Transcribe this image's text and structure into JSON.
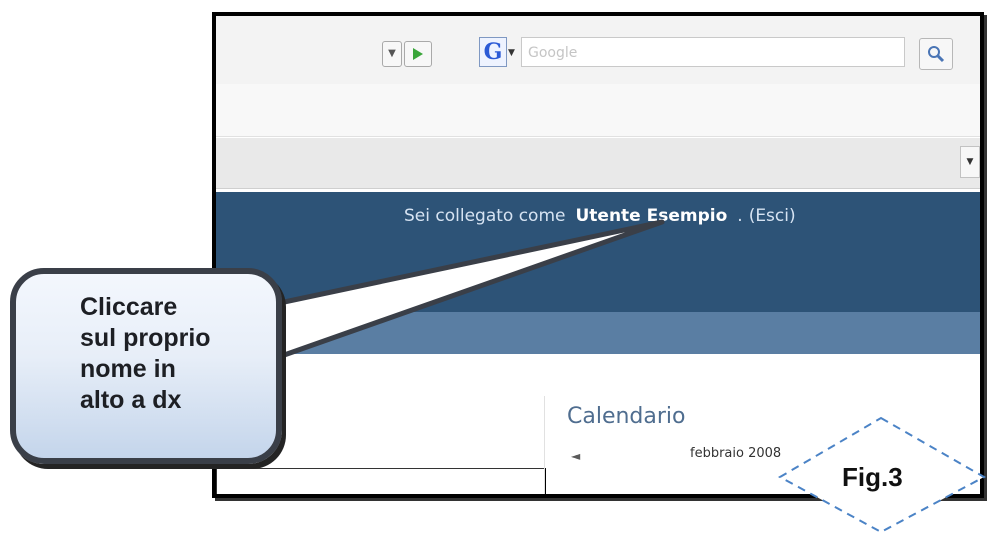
{
  "toolbar": {
    "search_placeholder": "Google",
    "google_badge": "G"
  },
  "header": {
    "login_prefix": "Sei collegato come",
    "user_name": "Utente Esempio",
    "separator": ".",
    "logout_link": "(Esci)"
  },
  "calendar": {
    "title": "Calendario",
    "prev_arrow": "◄",
    "month": "febbraio 2008"
  },
  "callout": {
    "lines": [
      "Cliccare",
      "sul proprio",
      "nome in",
      "alto a dx"
    ]
  },
  "figure": {
    "label": "Fig.3"
  },
  "icons": {
    "dropdown": "chevron-down-icon",
    "go": "play-arrow-icon",
    "search": "magnifier-icon"
  },
  "colors": {
    "header_blue": "#2d5377",
    "subheader_blue": "#5a7ea3",
    "callout_fill": "#e7eef8",
    "calendar_title": "#4f6d8f"
  }
}
